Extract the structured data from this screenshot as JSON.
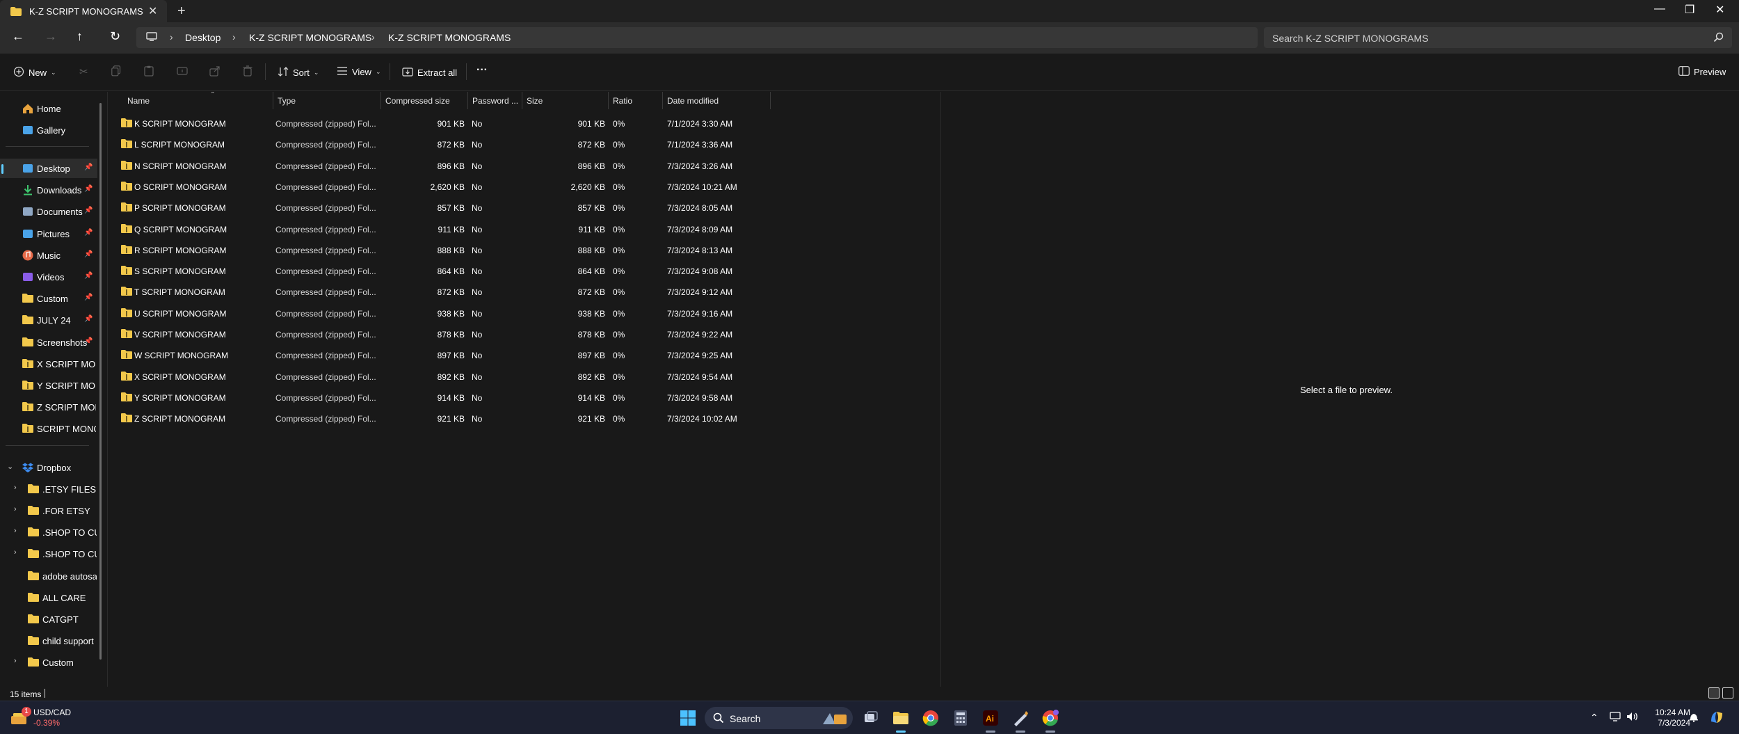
{
  "window": {
    "tab_title": "K-Z SCRIPT MONOGRAMS",
    "new_tab": "+",
    "tab_close": "✕",
    "minimize": "—",
    "maximize": "❐",
    "close": "✕"
  },
  "address": {
    "crumbs": [
      "Desktop",
      "K-Z SCRIPT MONOGRAMS",
      "K-Z SCRIPT MONOGRAMS"
    ],
    "search_placeholder": "Search K-Z SCRIPT MONOGRAMS"
  },
  "commands": {
    "new": "New",
    "sort": "Sort",
    "view": "View",
    "extract_all": "Extract all",
    "more": "···",
    "preview": "Preview"
  },
  "sidebar": {
    "quick": [
      {
        "label": "Home",
        "icon": "home-icon",
        "color": "#e8a33d"
      },
      {
        "label": "Gallery",
        "icon": "gallery-icon",
        "color": "#4aa3e8"
      }
    ],
    "pinned": [
      {
        "label": "Desktop",
        "icon": "desktop-icon",
        "color": "#4aa3e8",
        "pin": "📌",
        "selected": true
      },
      {
        "label": "Downloads",
        "icon": "downloads-icon",
        "color": "#3ec46d",
        "pin": "📌"
      },
      {
        "label": "Documents",
        "icon": "documents-icon",
        "color": "#8fa7c4",
        "pin": "📌"
      },
      {
        "label": "Pictures",
        "icon": "pictures-icon",
        "color": "#4aa3e8",
        "pin": "📌"
      },
      {
        "label": "Music",
        "icon": "music-icon",
        "color": "#e86b4a",
        "pin": "📌"
      },
      {
        "label": "Videos",
        "icon": "videos-icon",
        "color": "#8a5ce8",
        "pin": "📌"
      },
      {
        "label": "Custom",
        "icon": "folder-icon",
        "color": "#f2c84b",
        "pin": "📌"
      },
      {
        "label": "JULY 24",
        "icon": "folder-icon",
        "color": "#f2c84b",
        "pin": "📌"
      },
      {
        "label": "Screenshots",
        "icon": "folder-icon",
        "color": "#f2c84b",
        "pin": "📌"
      },
      {
        "label": "X SCRIPT MONC",
        "icon": "zip-folder-icon",
        "color": "#f2c84b"
      },
      {
        "label": "Y SCRIPT MONC",
        "icon": "zip-folder-icon",
        "color": "#f2c84b"
      },
      {
        "label": "Z SCRIPT MONC",
        "icon": "zip-folder-icon",
        "color": "#f2c84b"
      },
      {
        "label": "SCRIPT MONOC",
        "icon": "zip-folder-icon",
        "color": "#f2c84b"
      }
    ],
    "dropbox": {
      "label": "Dropbox",
      "icon": "dropbox-icon",
      "color": "#3d8cf0",
      "expander": "⌄"
    },
    "dropbox_children": [
      {
        "label": ".ETSY FILES",
        "expander": "›"
      },
      {
        "label": ".FOR ETSY",
        "expander": "›"
      },
      {
        "label": ".SHOP TO CUT",
        "expander": "›"
      },
      {
        "label": ".SHOP TO CUT",
        "expander": "›"
      },
      {
        "label": "adobe autosav",
        "expander": ""
      },
      {
        "label": "ALL CARE",
        "expander": ""
      },
      {
        "label": "CATGPT",
        "expander": ""
      },
      {
        "label": "child support",
        "expander": ""
      },
      {
        "label": "Custom",
        "expander": "›"
      }
    ]
  },
  "columns": {
    "name": "Name",
    "type": "Type",
    "compressed_size": "Compressed size",
    "password": "Password ...",
    "size": "Size",
    "ratio": "Ratio",
    "date_modified": "Date modified"
  },
  "files": [
    {
      "name": "K SCRIPT MONOGRAM",
      "type": "Compressed (zipped) Fol...",
      "csize": "901 KB",
      "password": "No",
      "size": "901 KB",
      "ratio": "0%",
      "date": "7/1/2024 3:30 AM"
    },
    {
      "name": "L SCRIPT MONOGRAM",
      "type": "Compressed (zipped) Fol...",
      "csize": "872 KB",
      "password": "No",
      "size": "872 KB",
      "ratio": "0%",
      "date": "7/1/2024 3:36 AM"
    },
    {
      "name": "N SCRIPT MONOGRAM",
      "type": "Compressed (zipped) Fol...",
      "csize": "896 KB",
      "password": "No",
      "size": "896 KB",
      "ratio": "0%",
      "date": "7/3/2024 3:26 AM"
    },
    {
      "name": "O SCRIPT MONOGRAM",
      "type": "Compressed (zipped) Fol...",
      "csize": "2,620 KB",
      "password": "No",
      "size": "2,620 KB",
      "ratio": "0%",
      "date": "7/3/2024 10:21 AM"
    },
    {
      "name": "P SCRIPT MONOGRAM",
      "type": "Compressed (zipped) Fol...",
      "csize": "857 KB",
      "password": "No",
      "size": "857 KB",
      "ratio": "0%",
      "date": "7/3/2024 8:05 AM"
    },
    {
      "name": "Q SCRIPT MONOGRAM",
      "type": "Compressed (zipped) Fol...",
      "csize": "911 KB",
      "password": "No",
      "size": "911 KB",
      "ratio": "0%",
      "date": "7/3/2024 8:09 AM"
    },
    {
      "name": "R SCRIPT MONOGRAM",
      "type": "Compressed (zipped) Fol...",
      "csize": "888 KB",
      "password": "No",
      "size": "888 KB",
      "ratio": "0%",
      "date": "7/3/2024 8:13 AM"
    },
    {
      "name": "S SCRIPT MONOGRAM",
      "type": "Compressed (zipped) Fol...",
      "csize": "864 KB",
      "password": "No",
      "size": "864 KB",
      "ratio": "0%",
      "date": "7/3/2024 9:08 AM"
    },
    {
      "name": "T SCRIPT MONOGRAM",
      "type": "Compressed (zipped) Fol...",
      "csize": "872 KB",
      "password": "No",
      "size": "872 KB",
      "ratio": "0%",
      "date": "7/3/2024 9:12 AM"
    },
    {
      "name": "U SCRIPT MONOGRAM",
      "type": "Compressed (zipped) Fol...",
      "csize": "938 KB",
      "password": "No",
      "size": "938 KB",
      "ratio": "0%",
      "date": "7/3/2024 9:16 AM"
    },
    {
      "name": "V SCRIPT MONOGRAM",
      "type": "Compressed (zipped) Fol...",
      "csize": "878 KB",
      "password": "No",
      "size": "878 KB",
      "ratio": "0%",
      "date": "7/3/2024 9:22 AM"
    },
    {
      "name": "W SCRIPT MONOGRAM",
      "type": "Compressed (zipped) Fol...",
      "csize": "897 KB",
      "password": "No",
      "size": "897 KB",
      "ratio": "0%",
      "date": "7/3/2024 9:25 AM"
    },
    {
      "name": "X SCRIPT MONOGRAM",
      "type": "Compressed (zipped) Fol...",
      "csize": "892 KB",
      "password": "No",
      "size": "892 KB",
      "ratio": "0%",
      "date": "7/3/2024 9:54 AM"
    },
    {
      "name": "Y SCRIPT MONOGRAM",
      "type": "Compressed (zipped) Fol...",
      "csize": "914 KB",
      "password": "No",
      "size": "914 KB",
      "ratio": "0%",
      "date": "7/3/2024 9:58 AM"
    },
    {
      "name": "Z SCRIPT MONOGRAM",
      "type": "Compressed (zipped) Fol...",
      "csize": "921 KB",
      "password": "No",
      "size": "921 KB",
      "ratio": "0%",
      "date": "7/3/2024 10:02 AM"
    }
  ],
  "preview": {
    "empty_text": "Select a file to preview."
  },
  "status": {
    "item_count": "15 items"
  },
  "taskbar": {
    "weather_title": "USD/CAD",
    "weather_sub": "-0.39%",
    "weather_badge": "1",
    "search_label": "Search",
    "time": "10:24 AM",
    "date": "7/3/2024"
  },
  "colors": {
    "accent": "#60cdff",
    "folder": "#f2c84b",
    "negative": "#ff6b6b"
  }
}
